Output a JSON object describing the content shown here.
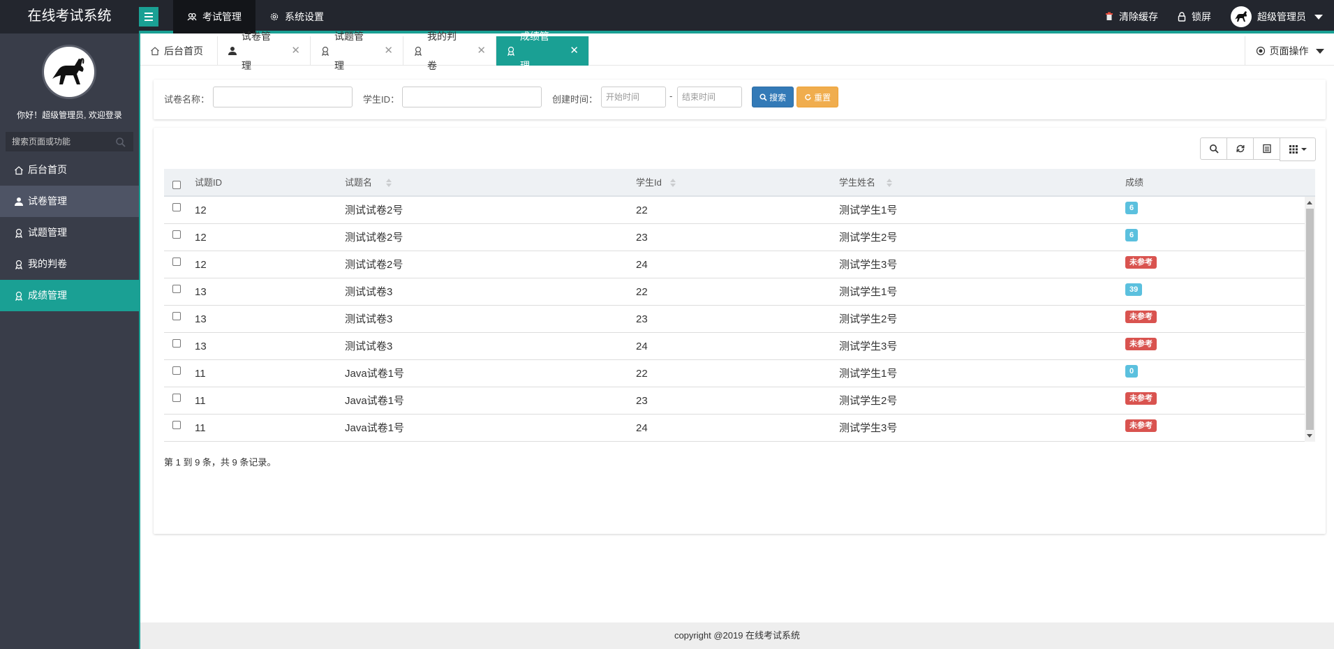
{
  "app": {
    "title": "在线考试系统"
  },
  "topnav": [
    {
      "label": "考试管理",
      "icon": "users-icon",
      "active": true
    },
    {
      "label": "系统设置",
      "icon": "gear-icon",
      "active": false
    }
  ],
  "topright": {
    "clear_cache": "清除缓存",
    "lock_screen": "锁屏",
    "user_name": "超级管理员"
  },
  "sidebar": {
    "welcome": "你好！超级管理员, 欢迎登录",
    "search_placeholder": "搜索页面或功能",
    "items": [
      {
        "label": "后台首页",
        "icon": "home-icon",
        "state": "normal"
      },
      {
        "label": "试卷管理",
        "icon": "user-icon",
        "state": "hover"
      },
      {
        "label": "试题管理",
        "icon": "award-icon",
        "state": "normal"
      },
      {
        "label": "我的判卷",
        "icon": "award-icon",
        "state": "normal"
      },
      {
        "label": "成绩管理",
        "icon": "award-icon",
        "state": "active"
      }
    ]
  },
  "tabs": [
    {
      "label": "后台首页",
      "icon": "home-icon",
      "closable": false,
      "active": false
    },
    {
      "label": "试卷管理",
      "icon": "user-icon",
      "closable": true,
      "active": false
    },
    {
      "label": "试题管理",
      "icon": "award-icon",
      "closable": true,
      "active": false
    },
    {
      "label": "我的判卷",
      "icon": "award-icon",
      "closable": true,
      "active": false
    },
    {
      "label": "成绩管理",
      "icon": "award-icon",
      "closable": true,
      "active": true
    }
  ],
  "page_ops": "页面操作",
  "search": {
    "paper_name_label": "试卷名称：",
    "paper_name_value": "",
    "student_id_label": "学生ID：",
    "student_id_value": "",
    "created_label": "创建时间：",
    "start_placeholder": "开始时间",
    "separator": "-",
    "end_placeholder": "结束时间",
    "search_button": "搜索",
    "reset_button": "重置"
  },
  "table": {
    "columns": [
      "试题ID",
      "试题名",
      "学生Id",
      "学生姓名",
      "成绩"
    ],
    "rows": [
      {
        "paper_id": "12",
        "paper_name": "测试试卷2号",
        "student_id": "22",
        "student_name": "测试学生1号",
        "score": "6",
        "score_type": "info"
      },
      {
        "paper_id": "12",
        "paper_name": "测试试卷2号",
        "student_id": "23",
        "student_name": "测试学生2号",
        "score": "6",
        "score_type": "info"
      },
      {
        "paper_id": "12",
        "paper_name": "测试试卷2号",
        "student_id": "24",
        "student_name": "测试学生3号",
        "score": "未参考",
        "score_type": "danger"
      },
      {
        "paper_id": "13",
        "paper_name": "测试试卷3",
        "student_id": "22",
        "student_name": "测试学生1号",
        "score": "39",
        "score_type": "info"
      },
      {
        "paper_id": "13",
        "paper_name": "测试试卷3",
        "student_id": "23",
        "student_name": "测试学生2号",
        "score": "未参考",
        "score_type": "danger"
      },
      {
        "paper_id": "13",
        "paper_name": "测试试卷3",
        "student_id": "24",
        "student_name": "测试学生3号",
        "score": "未参考",
        "score_type": "danger"
      },
      {
        "paper_id": "11",
        "paper_name": "Java试卷1号",
        "student_id": "22",
        "student_name": "测试学生1号",
        "score": "0",
        "score_type": "info"
      },
      {
        "paper_id": "11",
        "paper_name": "Java试卷1号",
        "student_id": "23",
        "student_name": "测试学生2号",
        "score": "未参考",
        "score_type": "danger"
      },
      {
        "paper_id": "11",
        "paper_name": "Java试卷1号",
        "student_id": "24",
        "student_name": "测试学生3号",
        "score": "未参考",
        "score_type": "danger"
      }
    ],
    "pagination": "第 1 到 9 条，共 9 条记录。"
  },
  "footer": "copyright @2019 在线考试系统",
  "colors": {
    "accent": "#1aa094",
    "header_bg": "#23262e",
    "sidebar_bg": "#393d49",
    "primary": "#337ab7",
    "warning": "#f0ad4e",
    "info": "#5bc0de",
    "danger": "#d9534f"
  }
}
